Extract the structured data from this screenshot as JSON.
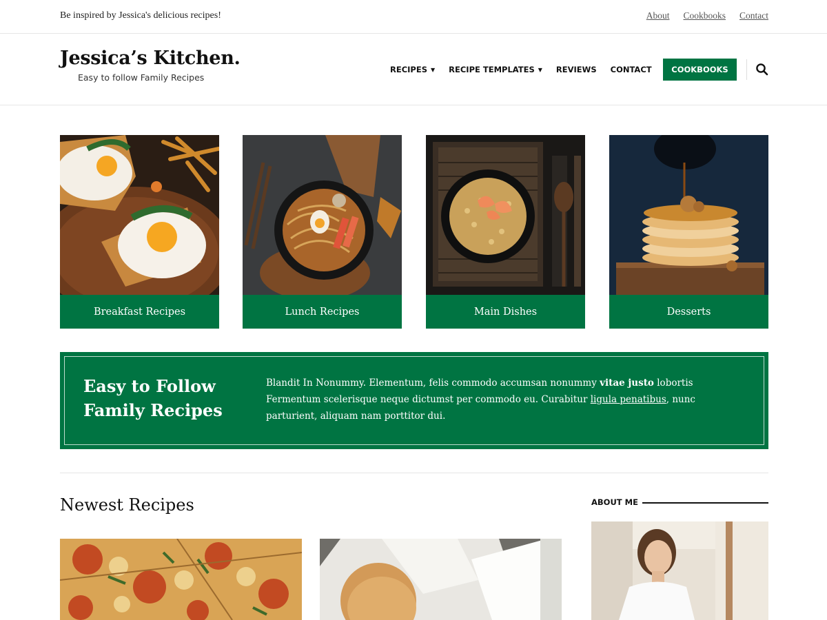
{
  "topbar": {
    "tagline": "Be inspired by Jessica's delicious recipes!",
    "links": [
      "About",
      "Cookbooks",
      "Contact"
    ]
  },
  "header": {
    "title": "Jessica’s Kitchen.",
    "subtitle": "Easy to follow Family Recipes",
    "nav": [
      {
        "label": "RECIPES",
        "dropdown": true
      },
      {
        "label": "RECIPE TEMPLATES",
        "dropdown": true
      },
      {
        "label": "REVIEWS",
        "dropdown": false
      },
      {
        "label": "CONTACT",
        "dropdown": false
      }
    ],
    "cta_label": "COOKBOOKS",
    "search_icon": "search-icon"
  },
  "categories": [
    {
      "label": "Breakfast Recipes",
      "image": "fried eggs on toast"
    },
    {
      "label": "Lunch Recipes",
      "image": "noodle bowl"
    },
    {
      "label": "Main Dishes",
      "image": "shrimp fried rice"
    },
    {
      "label": "Desserts",
      "image": "pancake stack with syrup"
    }
  ],
  "feature": {
    "title_line1": "Easy to Follow",
    "title_line2": "Family Recipes",
    "text_part1": "Blandit In Nonummy. Elementum, felis commodo accumsan nonummy ",
    "text_bold": "vitae justo",
    "text_part2": " lobortis Fermentum scelerisque neque dictumst per commodo eu. Curabitur ",
    "text_link": "ligula penatibus",
    "text_part3": ", nunc parturient, aliquam nam porttitor dui."
  },
  "newest": {
    "title": "Newest Recipes"
  },
  "sidebar": {
    "about_heading": "ABOUT ME"
  },
  "colors": {
    "brand_green": "#007442"
  }
}
